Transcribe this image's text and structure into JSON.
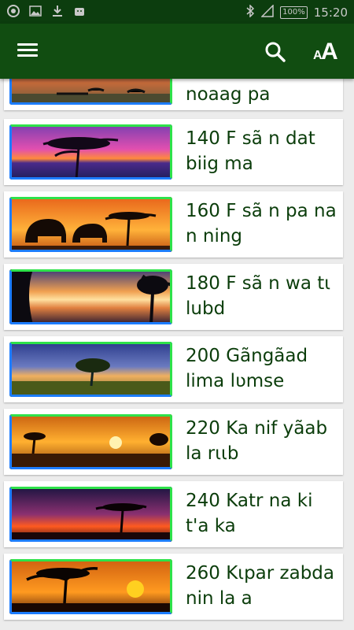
{
  "status_bar": {
    "battery": "100%",
    "time": "15:20"
  },
  "toolbar": {
    "menu_icon": "hamburger-icon",
    "search_icon": "search-icon",
    "font_icon": "font-size-icon",
    "font_small": "A",
    "font_big": "A"
  },
  "items": [
    {
      "title": "noaag pa",
      "thumb": "savanna-trees-dusk"
    },
    {
      "title": "140 F sã n dat biig ma",
      "thumb": "purple-sunset-tree"
    },
    {
      "title": "160 F sã n pa na n ning",
      "thumb": "elephants-sunset"
    },
    {
      "title": "180 F sã n wa tι lubd",
      "thumb": "lake-sunset-trees"
    },
    {
      "title": "200 Gãngãad lima lʋmse",
      "thumb": "savanna-acacia-dusk"
    },
    {
      "title": "220 Ka nif yãab la rιιb",
      "thumb": "orange-sunset-acacias"
    },
    {
      "title": "240 Katr na ki t'a ka",
      "thumb": "red-sunset-tree"
    },
    {
      "title": "260 Kιpar zabda nin la a",
      "thumb": "silhouette-sun"
    }
  ]
}
